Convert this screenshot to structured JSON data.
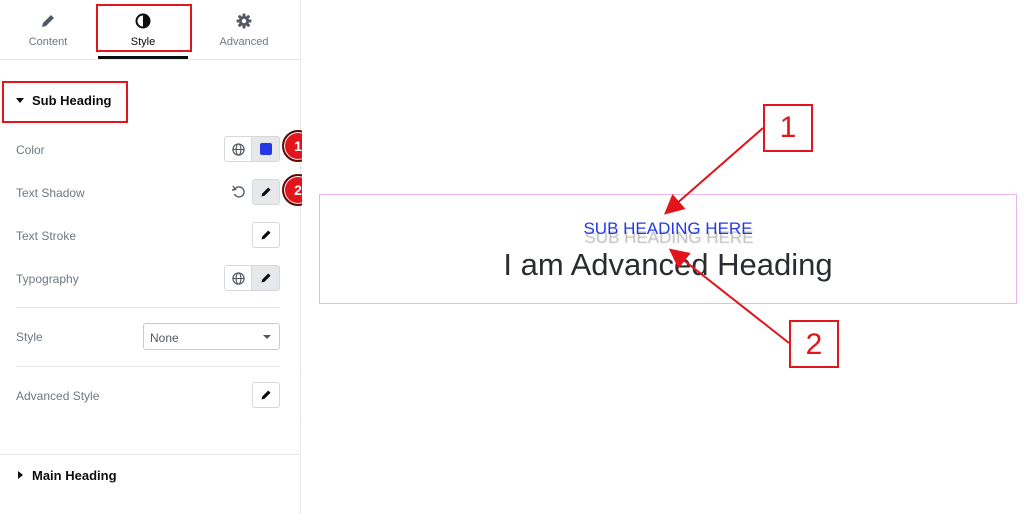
{
  "tabs": [
    {
      "label": "Content",
      "icon": "pencil-icon"
    },
    {
      "label": "Style",
      "icon": "contrast-icon"
    },
    {
      "label": "Advanced",
      "icon": "gear-icon"
    }
  ],
  "sections": {
    "sub_heading": "Sub Heading",
    "main_heading": "Main Heading"
  },
  "controls": {
    "color": "Color",
    "text_shadow": "Text Shadow",
    "text_stroke": "Text Stroke",
    "typography": "Typography",
    "style": "Style",
    "style_value": "None",
    "advanced_style": "Advanced Style"
  },
  "colors": {
    "accent": "#e2141c",
    "swatch": "#2438e8",
    "widget_border": "#e8b6ec"
  },
  "badges": [
    "1",
    "2"
  ],
  "preview": {
    "sub_heading": "SUB HEADING HERE",
    "main_heading": "I am Advanced Heading"
  },
  "callouts": [
    "1",
    "2"
  ]
}
